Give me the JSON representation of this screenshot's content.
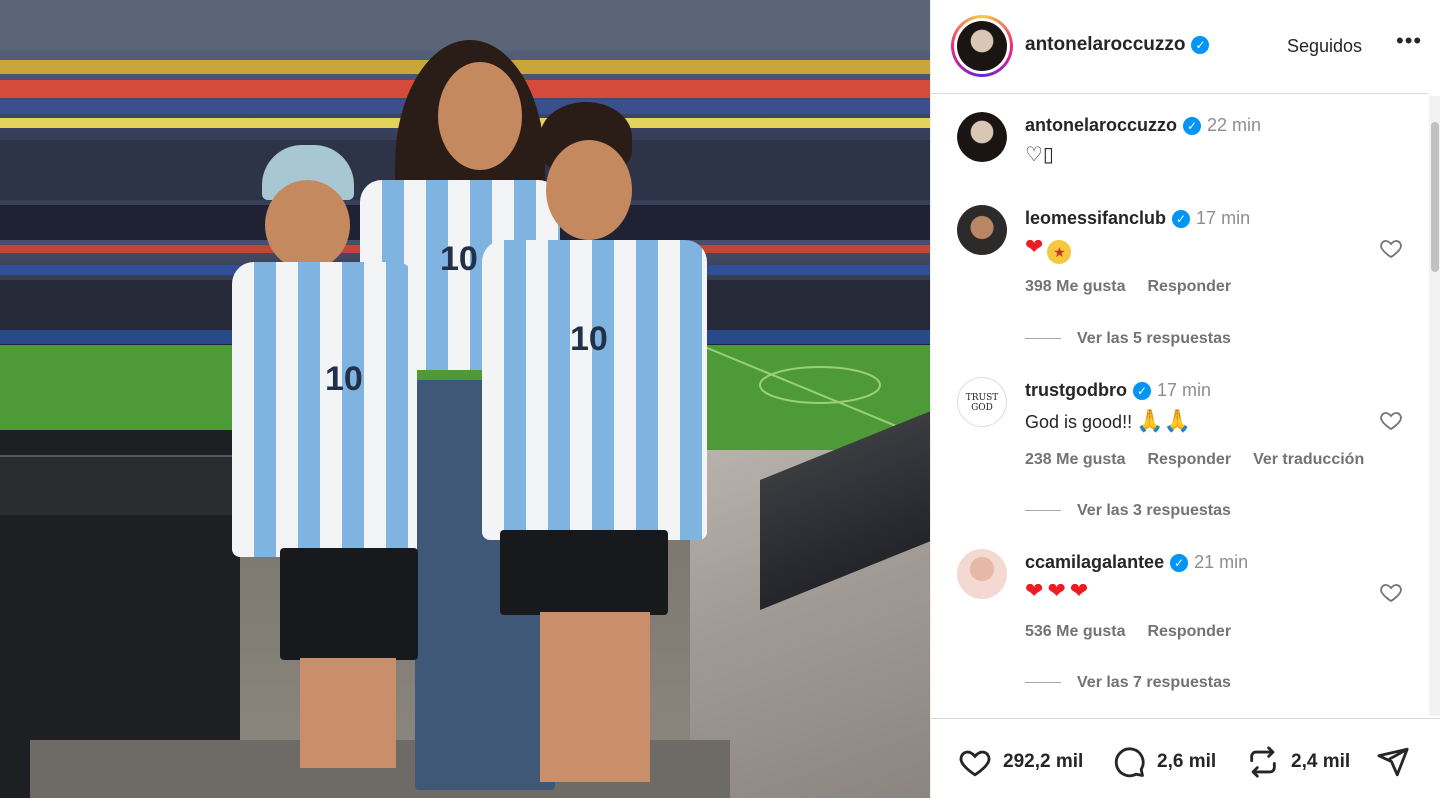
{
  "post": {
    "author": "antonelaroccuzzo",
    "follow_label": "Seguidos",
    "more_label": "•••"
  },
  "caption": {
    "user": "antonelaroccuzzo",
    "time": "22 min",
    "text": "♡▯"
  },
  "comments": [
    {
      "user": "leomessifanclub",
      "time": "17 min",
      "text_emojis": [
        "heart",
        "star-struck"
      ],
      "likes": "398 Me gusta",
      "reply_label": "Responder",
      "translate_label": "",
      "replies_label": "Ver las 5 respuestas"
    },
    {
      "user": "trustgodbro",
      "time": "17 min",
      "text": "God is good!!",
      "likes": "238 Me gusta",
      "reply_label": "Responder",
      "translate_label": "Ver traducción",
      "replies_label": "Ver las 3 respuestas"
    },
    {
      "user": "ccamilagalantee",
      "time": "21 min",
      "text_emojis": [
        "heart",
        "heart",
        "heart"
      ],
      "likes": "536 Me gusta",
      "reply_label": "Responder",
      "translate_label": "",
      "replies_label": "Ver las 7 respuestas"
    }
  ],
  "actions": {
    "likes": "292,2 mil",
    "comments": "2,6 mil",
    "reposts": "2,4 mil"
  },
  "icons": [
    "verified-icon",
    "heart-icon",
    "comment-icon",
    "repost-icon",
    "share-icon",
    "more-icon"
  ],
  "colors": {
    "verified": "#0095f6",
    "heart": "#ed1c24"
  }
}
